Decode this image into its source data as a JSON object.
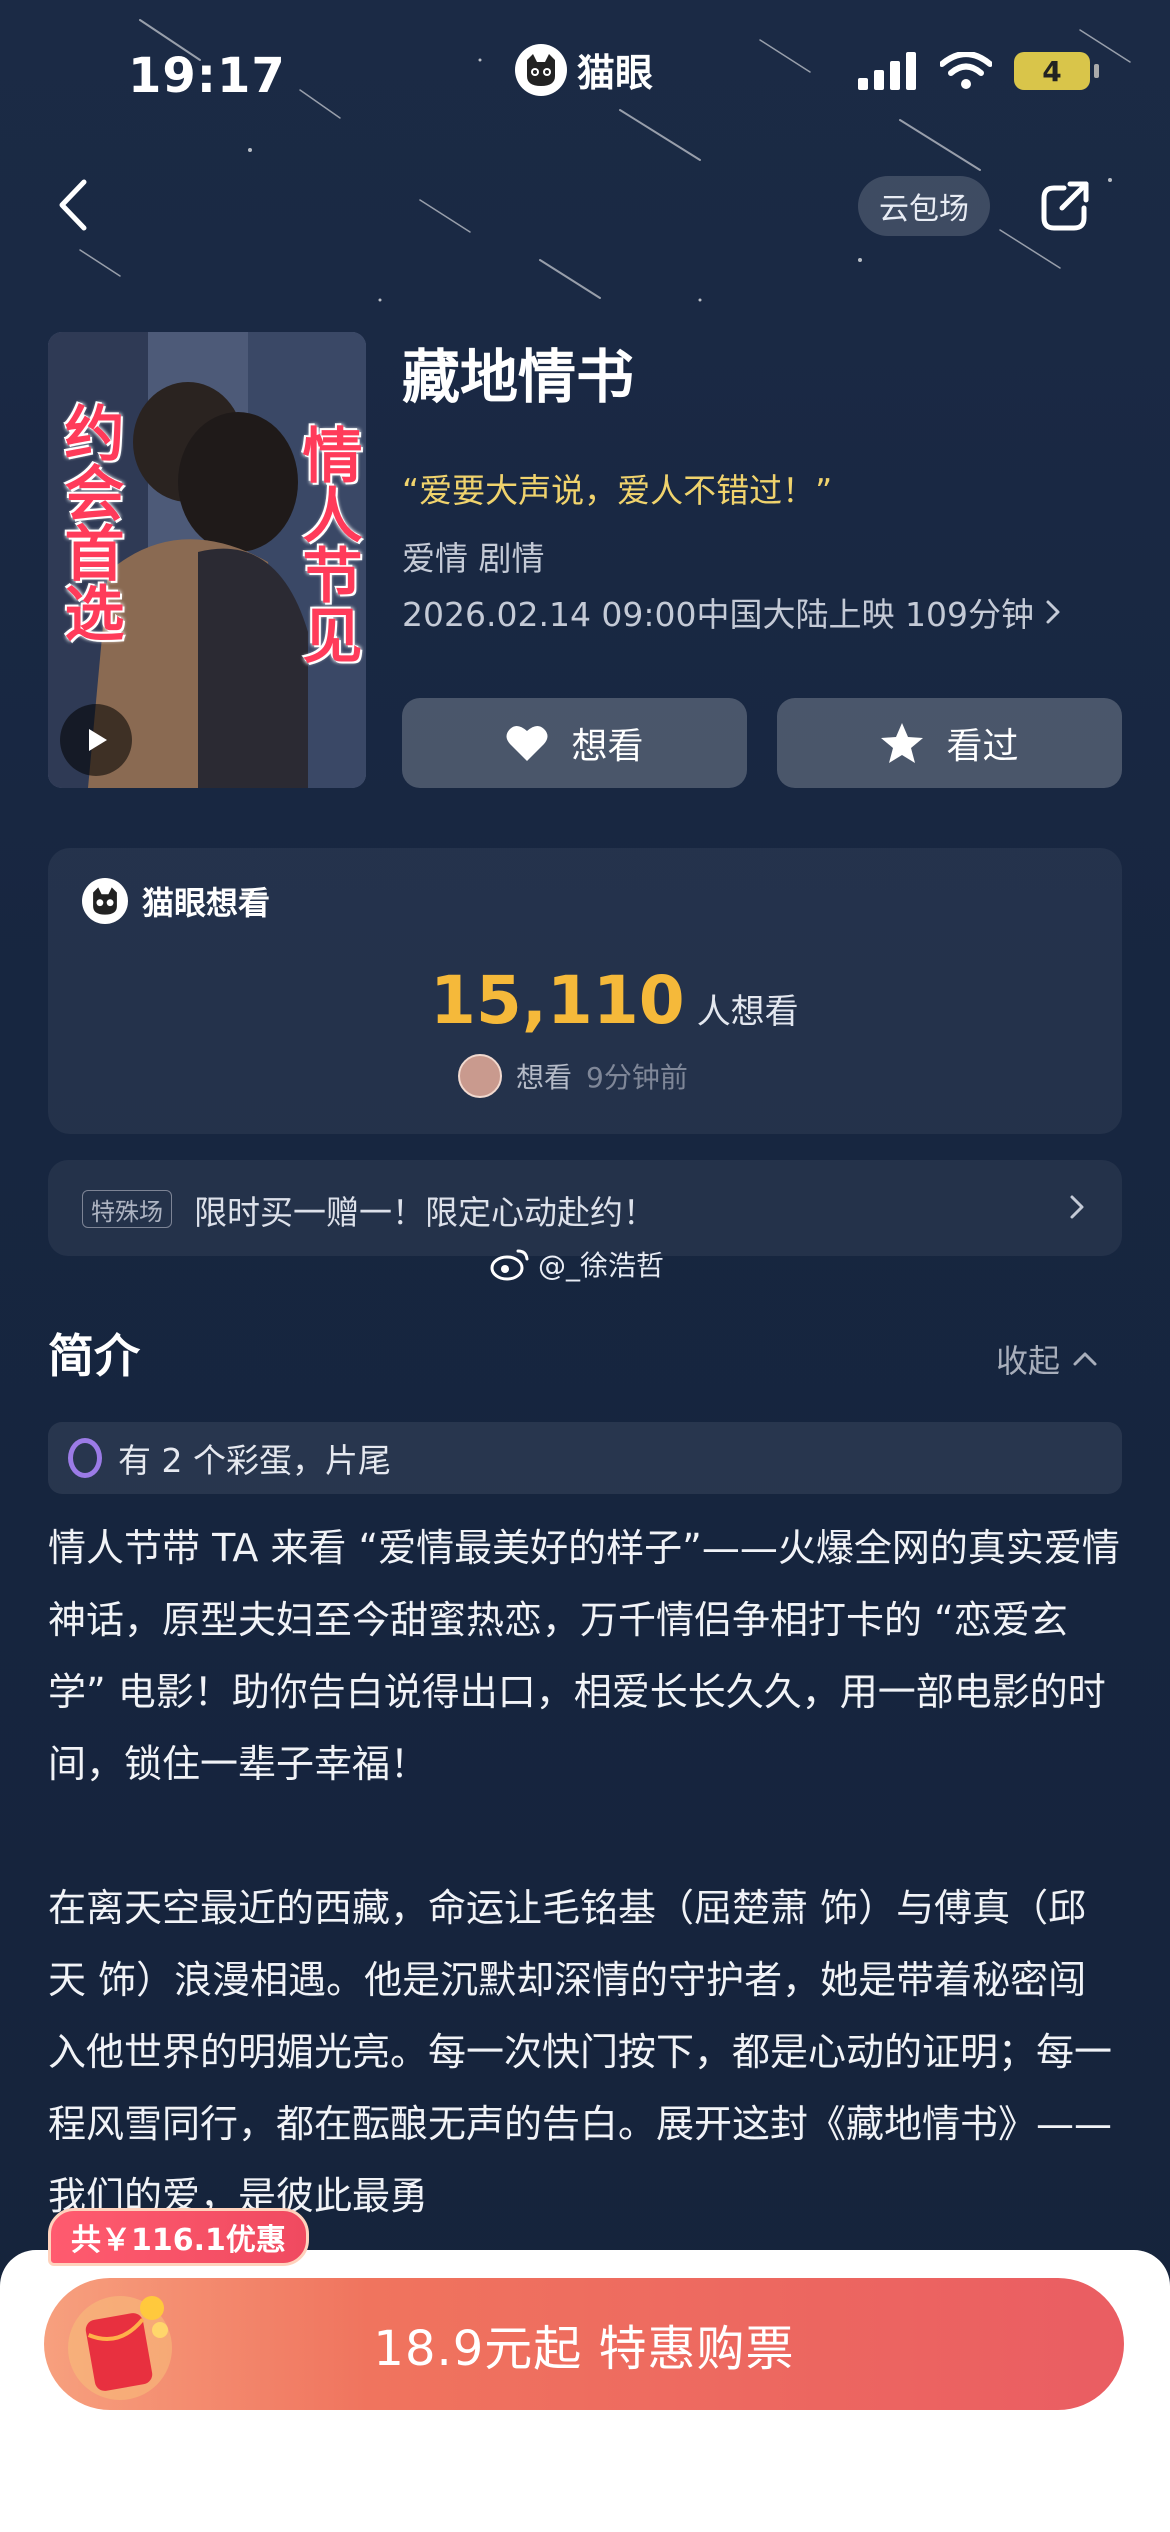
{
  "status_bar": {
    "time": "19:17",
    "brand_name": "猫眼",
    "battery": "4"
  },
  "header": {
    "cloud_label": "云包场"
  },
  "movie": {
    "title": "藏地情书",
    "slogan": "爱要大声说，爱人不错过！",
    "genres": "爱情 剧情",
    "release_info": "2026.02.14 09:00中国大陆上映 109分钟",
    "poster_text_left": "约会首选",
    "poster_text_right": "情人节见"
  },
  "actions": {
    "want_label": "想看",
    "seen_label": "看过"
  },
  "want_card": {
    "heading": "猫眼想看",
    "count": "15,110",
    "count_unit": "人想看",
    "recent_action": "想看",
    "recent_time": "9分钟前"
  },
  "promo": {
    "tag": "特殊场",
    "text": "限时买一赠一！限定心动赴约！"
  },
  "watermark": "@_徐浩哲",
  "intro": {
    "section_title": "简介",
    "collapse_label": "收起",
    "egg_text": "有 2 个彩蛋，片尾",
    "paragraph_1": "情人节带 TA 来看 “爱情最美好的样子”——火爆全网的真实爱情神话，原型夫妇至今甜蜜热恋，万千情侣争相打卡的 “恋爱玄学” 电影！助你告白说得出口，相爱长长久久，用一部电影的时间，锁住一辈子幸福！",
    "paragraph_2": "在离天空最近的西藏，命运让毛铭基（屈楚萧 饰）与傅真（邱天 饰）浪漫相遇。他是沉默却深情的守护者，她是带着秘密闯入他世界的明媚光亮。每一次快门按下，都是心动的证明；每一程风雪同行，都在酝酿无声的告白。展开这封《藏地情书》——我们的爱，是彼此最勇"
  },
  "purchase": {
    "discount_badge": "共￥116.1优惠",
    "button_label": "18.9元起 特惠购票"
  },
  "colors": {
    "accent_gold": "#f5b93a",
    "slogan_yellow": "#f0d36d",
    "buy_gradient_end": "#ea5d62"
  }
}
